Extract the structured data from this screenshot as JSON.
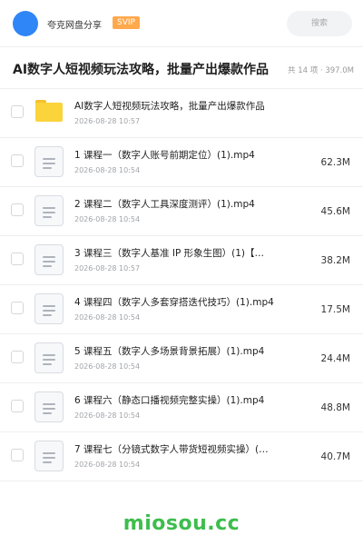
{
  "header": {
    "owner_name": "夸克网盘分享",
    "badge": "SVIP",
    "search_placeholder": "搜索"
  },
  "share": {
    "title": "AI数字人短视频玩法攻略，批量产出爆款作品",
    "meta": "共 14 项 · 397.0M"
  },
  "files": [
    {
      "type": "folder",
      "name": "AI数字人短视频玩法攻略，批量产出爆款作品",
      "date": "2026-08-28 10:57",
      "size": ""
    },
    {
      "type": "file",
      "name": "1 课程一（数字人账号前期定位）(1).mp4",
      "date": "2026-08-28 10:54",
      "size": "62.3M"
    },
    {
      "type": "file",
      "name": "2 课程二（数字人工具深度测评）(1).mp4",
      "date": "2026-08-28 10:54",
      "size": "45.6M"
    },
    {
      "type": "file",
      "name": "3 课程三（数字人基准 IP 形象生图）(1)【…",
      "date": "2026-08-28 10:57",
      "size": "38.2M"
    },
    {
      "type": "file",
      "name": "4 课程四（数字人多套穿搭迭代技巧）(1).mp4",
      "date": "2026-08-28 10:54",
      "size": "17.5M"
    },
    {
      "type": "file",
      "name": "5 课程五（数字人多场景背景拓展）(1).mp4",
      "date": "2026-08-28 10:54",
      "size": "24.4M"
    },
    {
      "type": "file",
      "name": "6 课程六（静态口播视频完整实操）(1).mp4",
      "date": "2026-08-28 10:54",
      "size": "48.8M"
    },
    {
      "type": "file",
      "name": "7 课程七（分镜式数字人带货短视频实操）(1).…",
      "date": "2026-08-28 10:54",
      "size": "40.7M"
    }
  ],
  "watermark": "miosou.cc",
  "colors": {
    "avatar": "#2f86f6",
    "svip_badge": "#ffa94d",
    "folder": "#fbd33b",
    "watermark": "#3dbd4d"
  }
}
